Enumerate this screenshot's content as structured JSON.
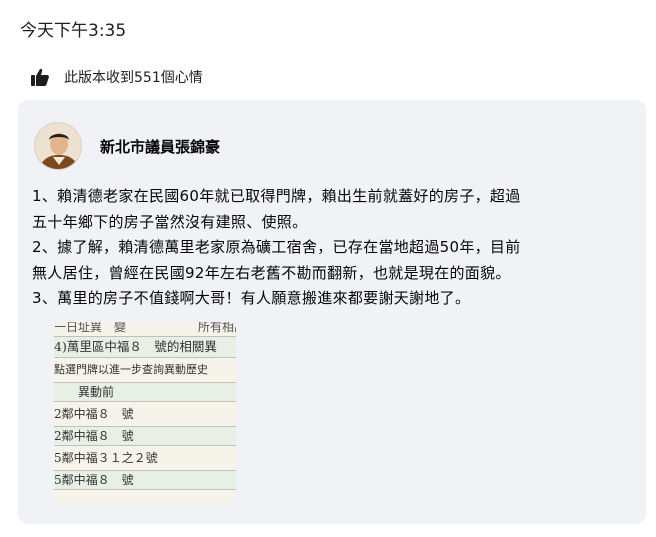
{
  "timestamp": "今天下午3:35",
  "likes": {
    "text": "此版本收到551個心情",
    "icon": "thumbs-up-icon"
  },
  "shared_post": {
    "author": "新北市議員張錦豪",
    "paragraphs": [
      "1、賴清德老家在民國60年就已取得門牌，賴出生前就蓋好的房子，超過",
      "五十年鄉下的房子當然沒有建照、使照。",
      "2、據了解，賴清德萬里老家原為礦工宿舍，已存在當地超過50年，目前",
      "無人居住，曾經在民國92年左右老舊不勘而翻新，也就是現在的面貌。",
      "3、萬里的房子不值錢啊大哥！有人願意搬進來都要謝天謝地了。"
    ],
    "image_rows": [
      "一日址異　變　　　　　　所有相關異",
      "4)萬里區中福８　號的相關異",
      "點選門牌以進一步查詢異動歷史",
      "　　異動前",
      "2鄰中福８　號",
      "2鄰中福８　號",
      "5鄰中福３１之２號",
      "5鄰中福８　號"
    ]
  }
}
